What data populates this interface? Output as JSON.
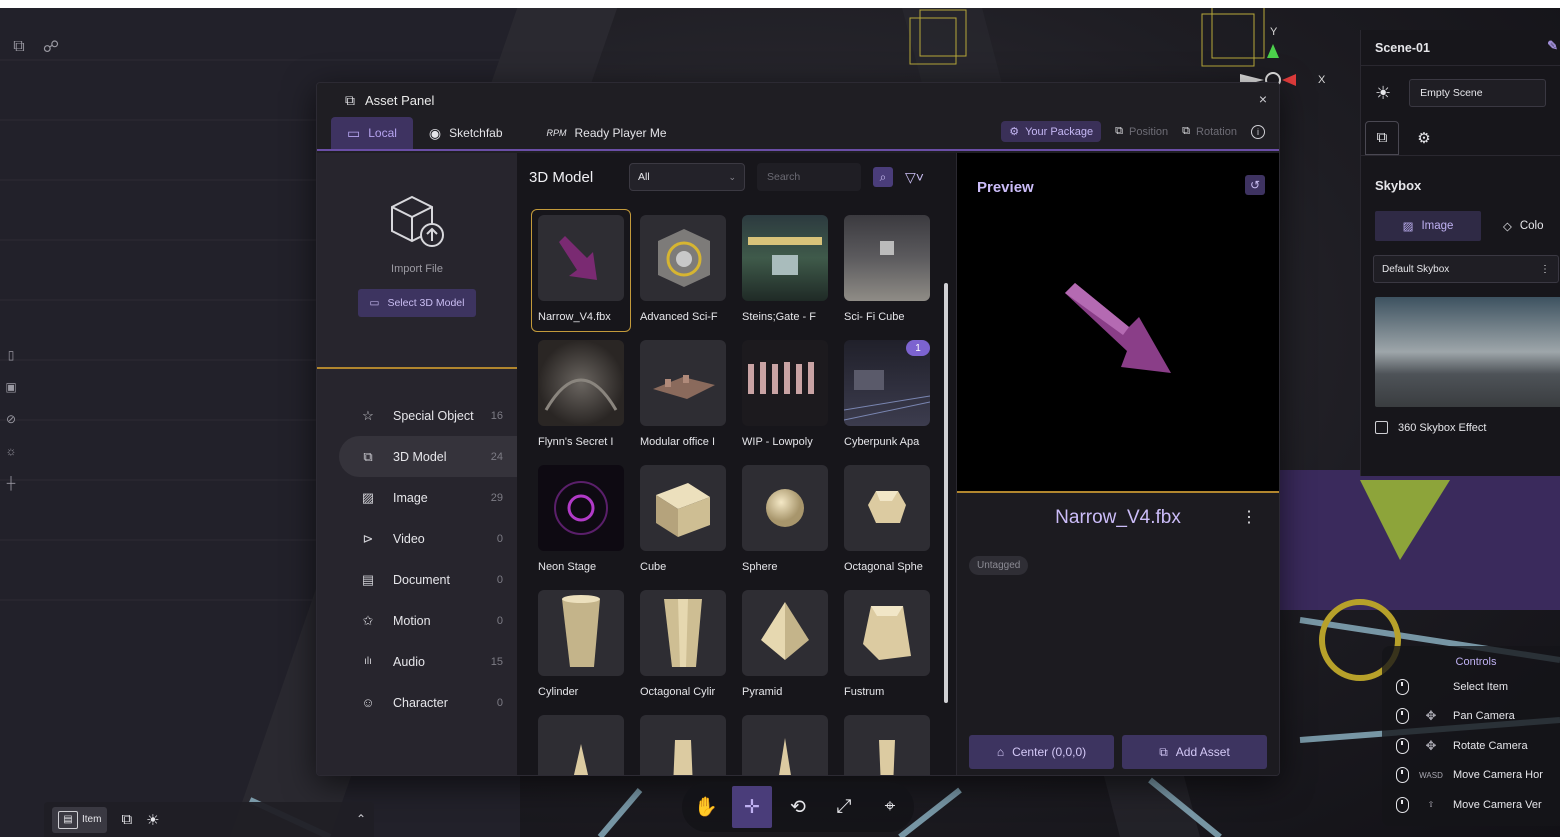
{
  "panel": {
    "title": "Asset Panel",
    "close": "×",
    "tabs": [
      {
        "label": "Local",
        "icon": "monitor-icon"
      },
      {
        "label": "Sketchfab",
        "icon": "sketchfab-icon"
      },
      {
        "label": "Ready Player Me",
        "icon": "rpm-icon"
      }
    ],
    "your_package": "Your Package",
    "position": "Position",
    "rotation": "Rotation"
  },
  "sidebar": {
    "import_label": "Import File",
    "select_button": "Select 3D Model",
    "categories": [
      {
        "label": "Special Object",
        "count": "16"
      },
      {
        "label": "3D Model",
        "count": "24"
      },
      {
        "label": "Image",
        "count": "29"
      },
      {
        "label": "Video",
        "count": "0"
      },
      {
        "label": "Document",
        "count": "0"
      },
      {
        "label": "Motion",
        "count": "0"
      },
      {
        "label": "Audio",
        "count": "15"
      },
      {
        "label": "Character",
        "count": "0"
      }
    ]
  },
  "grid": {
    "title": "3D Model",
    "filter_value": "All",
    "search_placeholder": "Search",
    "items": [
      {
        "label": "Narrow_V4.fbx"
      },
      {
        "label": "Advanced Sci-F"
      },
      {
        "label": "Steins;Gate - F"
      },
      {
        "label": "Sci- Fi Cube"
      },
      {
        "label": "Flynn's Secret I"
      },
      {
        "label": "Modular office I"
      },
      {
        "label": "WIP - Lowpoly"
      },
      {
        "label": "Cyberpunk Apa",
        "badge": "1"
      },
      {
        "label": "Neon Stage"
      },
      {
        "label": "Cube"
      },
      {
        "label": "Sphere"
      },
      {
        "label": "Octagonal Sphe"
      },
      {
        "label": "Cylinder"
      },
      {
        "label": "Octagonal Cylir"
      },
      {
        "label": "Pyramid"
      },
      {
        "label": "Fustrum"
      }
    ]
  },
  "preview": {
    "title": "Preview",
    "asset_name": "Narrow_V4.fbx",
    "tag": "Untagged",
    "center_button": "Center (0,0,0)",
    "add_button": "Add Asset"
  },
  "inspector": {
    "scene_name": "Scene-01",
    "scene_type": "Empty Scene",
    "section": "Skybox",
    "mode_image": "Image",
    "mode_color": "Colo",
    "skybox_value": "Default Skybox",
    "effect_label": "360 Skybox Effect"
  },
  "controls": {
    "title": "Controls",
    "items": [
      {
        "label": "Select Item"
      },
      {
        "label": "Pan Camera"
      },
      {
        "label": "Rotate Camera"
      },
      {
        "label": "Move Camera Hor"
      },
      {
        "label": "Move Camera Ver"
      }
    ]
  },
  "bottom": {
    "item_label": "Item"
  },
  "axes": {
    "x": "X",
    "y": "Y"
  },
  "colors": {
    "accent": "#6a4ea6",
    "highlight": "#b1862e"
  }
}
